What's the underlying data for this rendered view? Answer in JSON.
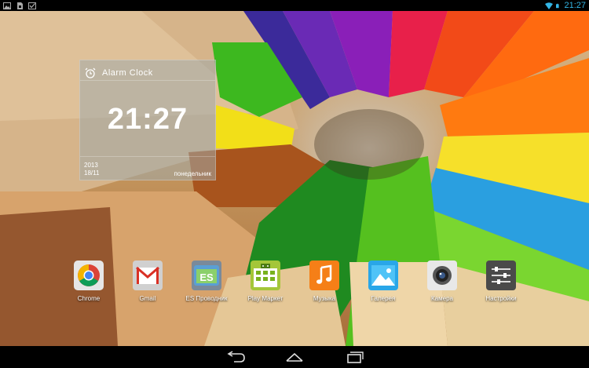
{
  "status_bar": {
    "time": "21:27",
    "left_icons": [
      "photo-icon",
      "sim-icon",
      "checkbox-icon"
    ],
    "right_icons": [
      "wifi-icon",
      "battery-icon"
    ],
    "accent": "#33b5e5"
  },
  "clock_widget": {
    "title": "Alarm Clock",
    "time": "21:27",
    "year": "2013",
    "date": "18/11",
    "weekday": "понедельник"
  },
  "apps": [
    {
      "label": "Chrome",
      "icon": "chrome-icon"
    },
    {
      "label": "Gmail",
      "icon": "gmail-icon"
    },
    {
      "label": "ES Проводник",
      "icon": "es-explorer-icon"
    },
    {
      "label": "Play Маркет",
      "icon": "play-market-icon"
    },
    {
      "label": "Музыка",
      "icon": "music-icon"
    },
    {
      "label": "Галерея",
      "icon": "gallery-icon"
    },
    {
      "label": "Камера",
      "icon": "camera-icon"
    },
    {
      "label": "Настройки",
      "icon": "settings-icon"
    }
  ],
  "nav_bar": {
    "buttons": [
      "back-icon",
      "home-icon",
      "recent-apps-icon"
    ]
  }
}
